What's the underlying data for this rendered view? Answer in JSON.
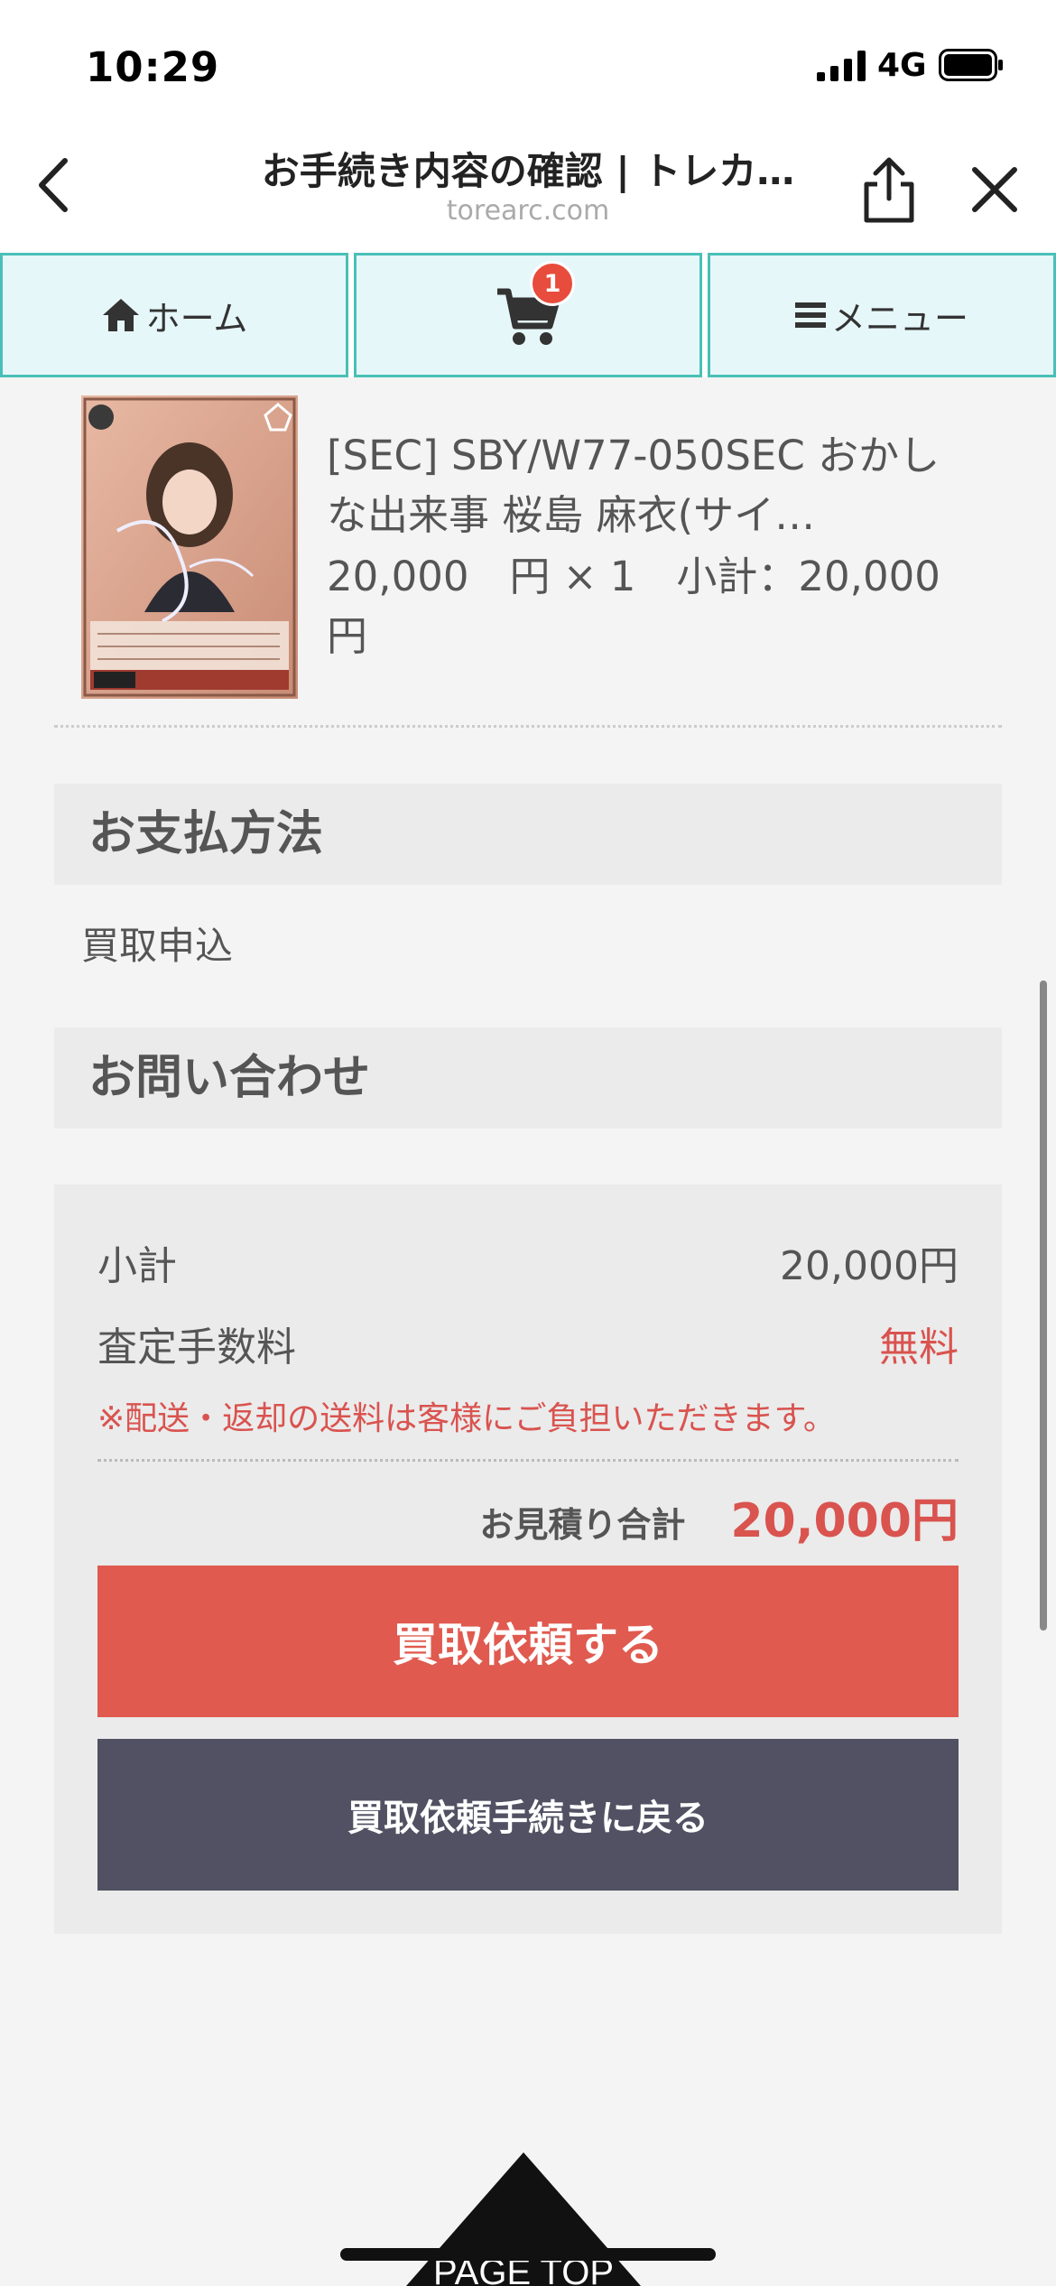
{
  "status_bar": {
    "time": "10:29",
    "network": "4G"
  },
  "browser": {
    "title": "お手続き内容の確認 | トレカ…",
    "host": "torearc.com"
  },
  "nav": {
    "home_label": "ホーム",
    "cart_count": "1",
    "menu_label": "メニュー",
    "accent_color": "#49c0b6"
  },
  "product": {
    "name": "[SEC] SBY/W77-050SEC おかしな出来事 桜島 麻衣(サイ…",
    "price_line": "20,000　円 × 1　小計：20,000　円"
  },
  "payment": {
    "heading": "お支払方法",
    "method": "買取申込"
  },
  "inquiry": {
    "heading": "お問い合わせ"
  },
  "summary": {
    "subtotal_label": "小計",
    "subtotal_value": "20,000円",
    "fee_label": "査定手数料",
    "fee_value": "無料",
    "note": "※配送・返却の送料は客様にご負担いただきます。",
    "total_label": "お見積り合計",
    "total_value": "20,000円",
    "submit_label": "買取依頼する",
    "back_label": "買取依頼手続きに戻る"
  },
  "page_top_label": "PAGE TOP"
}
